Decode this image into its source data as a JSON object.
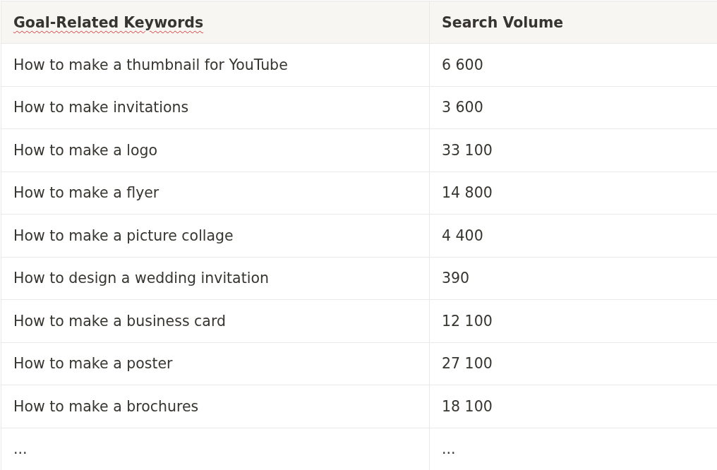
{
  "table": {
    "columns": [
      {
        "label": "Goal-Related Keywords",
        "spellcheck_error": true
      },
      {
        "label": "Search Volume",
        "spellcheck_error": false
      }
    ],
    "rows": [
      [
        "How to make a thumbnail for YouTube",
        "6 600"
      ],
      [
        "How to make invitations",
        "3 600"
      ],
      [
        "How to make a logo",
        "33 100"
      ],
      [
        "How to make a flyer",
        "14 800"
      ],
      [
        "How to make a picture collage",
        "4 400"
      ],
      [
        "How to design a wedding invitation",
        "390"
      ],
      [
        "How to make a business card",
        "12 100"
      ],
      [
        "How to make a poster",
        "27 100"
      ],
      [
        "How to make a brochures",
        "18 100"
      ],
      [
        "...",
        "..."
      ]
    ]
  }
}
